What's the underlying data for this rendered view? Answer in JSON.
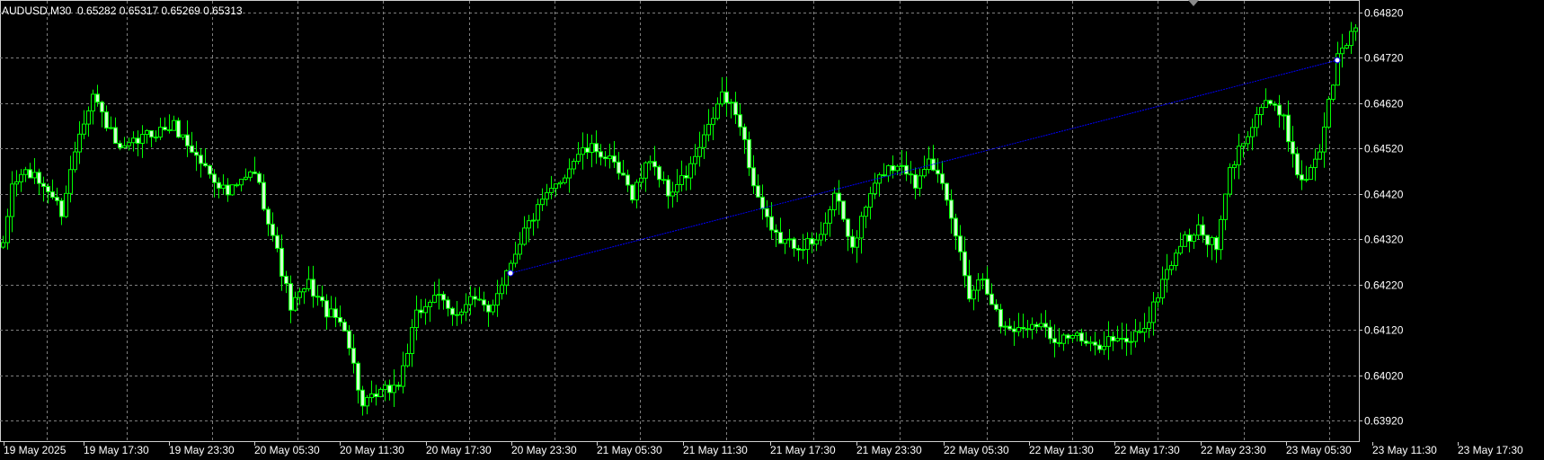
{
  "chart_info": {
    "symbol_timeframe": "AUDUSD,M30",
    "ohlc": "0.65282 0.65317 0.65269 0.65313"
  },
  "colors": {
    "background": "#000000",
    "grid": "#7f7f7f",
    "axis_text": "#ffffff",
    "bull_candle_body": "#000000",
    "bull_candle_border": "#00ff00",
    "bear_candle_body": "#ccffcc",
    "wick": "#00ff00",
    "trendline": "#0000ff"
  },
  "chart_data": {
    "type": "candlestick",
    "price_axis_labels": [
      "0.64820",
      "0.64720",
      "0.64620",
      "0.64520",
      "0.64420",
      "0.64320",
      "0.64220",
      "0.64120",
      "0.64020",
      "0.63920"
    ],
    "time_axis_labels": [
      "19 May 2025",
      "19 May 17:30",
      "19 May 23:30",
      "20 May 05:30",
      "20 May 11:30",
      "20 May 17:30",
      "20 May 23:30",
      "21 May 05:30",
      "21 May 11:30",
      "21 May 17:30",
      "21 May 23:30",
      "22 May 05:30",
      "22 May 11:30",
      "22 May 17:30",
      "22 May 23:30",
      "23 May 05:30",
      "23 May 11:30",
      "23 May 17:30"
    ],
    "ylim": [
      0.639,
      0.6484
    ],
    "grid": true,
    "price_axis_position": "right",
    "trendline": {
      "start": {
        "bar": 113,
        "price": 0.64245
      },
      "end": {
        "bar": 297,
        "price": 0.64715
      }
    },
    "anchor_points": [
      {
        "bar": 113,
        "price": 0.64245
      },
      {
        "bar": 297,
        "price": 0.64715
      }
    ],
    "waypoints": [
      [
        0,
        0.643
      ],
      [
        2,
        0.6444
      ],
      [
        5,
        0.6447
      ],
      [
        10,
        0.6443
      ],
      [
        13,
        0.6438
      ],
      [
        17,
        0.6456
      ],
      [
        20,
        0.6464
      ],
      [
        26,
        0.6451
      ],
      [
        32,
        0.6455
      ],
      [
        38,
        0.6457
      ],
      [
        44,
        0.6449
      ],
      [
        50,
        0.6442
      ],
      [
        56,
        0.6447
      ],
      [
        60,
        0.6433
      ],
      [
        64,
        0.6417
      ],
      [
        68,
        0.6422
      ],
      [
        72,
        0.6416
      ],
      [
        76,
        0.6413
      ],
      [
        80,
        0.6395
      ],
      [
        84,
        0.6398
      ],
      [
        88,
        0.64
      ],
      [
        92,
        0.6415
      ],
      [
        96,
        0.642
      ],
      [
        100,
        0.6415
      ],
      [
        104,
        0.6419
      ],
      [
        108,
        0.6416
      ],
      [
        112,
        0.6425
      ],
      [
        116,
        0.6434
      ],
      [
        120,
        0.644
      ],
      [
        124,
        0.6445
      ],
      [
        128,
        0.6451
      ],
      [
        132,
        0.6452
      ],
      [
        136,
        0.6448
      ],
      [
        140,
        0.6442
      ],
      [
        144,
        0.645
      ],
      [
        148,
        0.6442
      ],
      [
        152,
        0.6446
      ],
      [
        156,
        0.6454
      ],
      [
        160,
        0.6464
      ],
      [
        164,
        0.6458
      ],
      [
        167,
        0.6444
      ],
      [
        171,
        0.6433
      ],
      [
        175,
        0.6431
      ],
      [
        181,
        0.6431
      ],
      [
        185,
        0.6442
      ],
      [
        189,
        0.643
      ],
      [
        193,
        0.6442
      ],
      [
        196,
        0.6447
      ],
      [
        200,
        0.6449
      ],
      [
        203,
        0.6444
      ],
      [
        206,
        0.6451
      ],
      [
        209,
        0.6443
      ],
      [
        212,
        0.6433
      ],
      [
        215,
        0.642
      ],
      [
        218,
        0.6424
      ],
      [
        222,
        0.6413
      ],
      [
        226,
        0.6412
      ],
      [
        230,
        0.6414
      ],
      [
        234,
        0.641
      ],
      [
        238,
        0.6411
      ],
      [
        242,
        0.6408
      ],
      [
        246,
        0.641
      ],
      [
        250,
        0.6409
      ],
      [
        255,
        0.6414
      ],
      [
        258,
        0.6423
      ],
      [
        262,
        0.6431
      ],
      [
        266,
        0.6434
      ],
      [
        270,
        0.643
      ],
      [
        273,
        0.6447
      ],
      [
        277,
        0.6456
      ],
      [
        281,
        0.6463
      ],
      [
        285,
        0.6458
      ],
      [
        289,
        0.6444
      ],
      [
        293,
        0.6452
      ],
      [
        297,
        0.6472
      ],
      [
        301,
        0.6479
      ]
    ],
    "bar_count": 302
  }
}
